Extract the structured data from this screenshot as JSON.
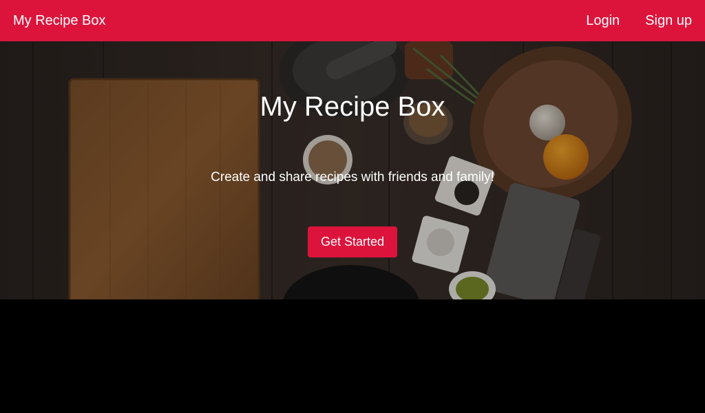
{
  "navbar": {
    "brand": "My Recipe Box",
    "links": [
      {
        "label": "Login"
      },
      {
        "label": "Sign up"
      }
    ],
    "color": "#dc143c"
  },
  "hero": {
    "title": "My Recipe Box",
    "subtitle": "Create and share recipes with friends and family!",
    "cta_label": "Get Started",
    "background": "kitchen-table-photo"
  },
  "colors": {
    "accent": "#dc143c",
    "page_background": "#000000",
    "text": "#ffffff"
  }
}
